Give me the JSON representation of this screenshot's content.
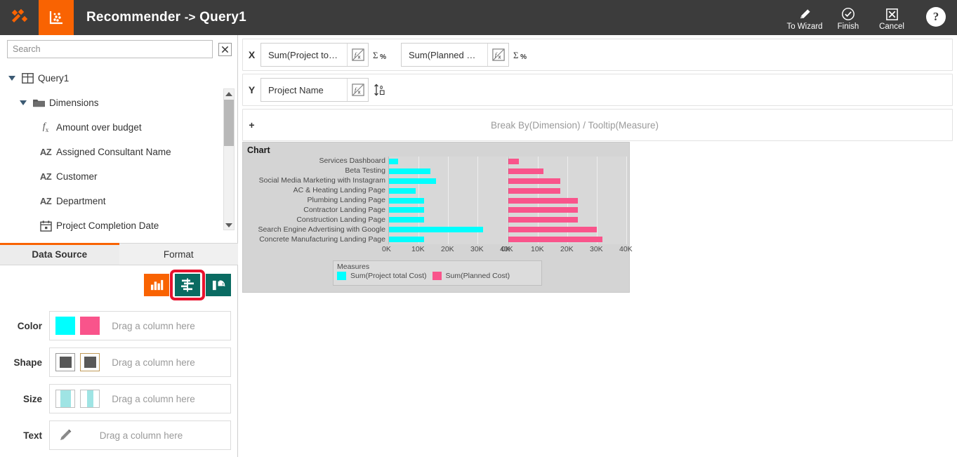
{
  "topbar": {
    "title_main": "Recommender",
    "title_arrow": "->",
    "title_query": "Query1",
    "app_icon": "scatter-plot-icon",
    "logo_icon": "tools-logo-icon",
    "actions": [
      {
        "label": "To Wizard",
        "icon": "pencil-icon"
      },
      {
        "label": "Finish",
        "icon": "check-circle-icon"
      },
      {
        "label": "Cancel",
        "icon": "x-box-icon"
      }
    ],
    "help_label": "?",
    "bg_color": "#3c3c3c",
    "accent_color": "#F96302"
  },
  "sidebar": {
    "search": {
      "placeholder": "Search",
      "value": ""
    },
    "clear_label": "✕",
    "tree": [
      {
        "label": "Query1",
        "icon": "table-icon",
        "indent": 0,
        "expanded": true
      },
      {
        "label": "Dimensions",
        "icon": "folder-icon",
        "indent": 1,
        "expanded": true
      },
      {
        "label": "Amount over budget",
        "icon": "formula-icon",
        "indent": 2,
        "expanded": false
      },
      {
        "label": "Assigned Consultant Name",
        "icon": "text-az-icon",
        "indent": 2,
        "expanded": false
      },
      {
        "label": "Customer",
        "icon": "text-az-icon",
        "indent": 2,
        "expanded": false
      },
      {
        "label": "Department",
        "icon": "text-az-icon",
        "indent": 2,
        "expanded": false
      },
      {
        "label": "Project Completion Date",
        "icon": "calendar-icon",
        "indent": 2,
        "expanded": false
      }
    ],
    "tabs": [
      {
        "label": "Data Source",
        "active": true
      },
      {
        "label": "Format",
        "active": false
      }
    ],
    "vis_buttons": [
      {
        "name": "bar-chart-vis",
        "icon": "bar-chart-icon",
        "selected": false,
        "color": "#F96302"
      },
      {
        "name": "diverging-bar-vis",
        "icon": "diverging-bar-icon",
        "selected": true,
        "color": "#0A6B62"
      },
      {
        "name": "rotate-chart-vis",
        "icon": "rotate-chart-icon",
        "selected": false,
        "color": "#0A6B62"
      }
    ],
    "drop_shelves": [
      {
        "label": "Color",
        "placeholder": "Drag a column here",
        "swatch_type": "color",
        "swatches": [
          "#00FFFF",
          "#F9548B"
        ]
      },
      {
        "label": "Shape",
        "placeholder": "Drag a column here",
        "swatch_type": "shape",
        "swatches": [
          "#595959",
          "#595959"
        ]
      },
      {
        "label": "Size",
        "placeholder": "Drag a column here",
        "swatch_type": "size",
        "swatches": [
          "#9FE4E4",
          "#9FE4E4"
        ]
      },
      {
        "label": "Text",
        "placeholder": "Drag a column here",
        "swatch_type": "pencil",
        "swatches": []
      }
    ]
  },
  "shelves": {
    "x": {
      "key": "X",
      "fields": [
        {
          "text": "Sum(Project total Co...",
          "fx_icon": "fx-slash-icon",
          "agg_icon": "Σ‰",
          "agg_name": "sum-percent-icon"
        },
        {
          "text": "Sum(Planned Cost)",
          "fx_icon": "fx-slash-icon",
          "agg_icon": "Σ‰",
          "agg_name": "sum-percent-icon"
        }
      ]
    },
    "y": {
      "key": "Y",
      "fields": [
        {
          "text": "Project Name",
          "fx_icon": "fx-slash-icon",
          "agg_icon": "↕",
          "agg_name": "sort-icon"
        }
      ]
    },
    "breakby": {
      "key": "+",
      "placeholder": "Break By(Dimension) / Tooltip(Measure)"
    }
  },
  "chart_data": {
    "type": "bar",
    "title": "Chart",
    "orientation": "horizontal",
    "layout": "mirrored-panels",
    "categories": [
      "Services Dashboard",
      "Beta Testing",
      "Social Media Marketing with Instagram",
      "AC & Heating Landing Page",
      "Plumbing Landing Page",
      "Contractor Landing Page",
      "Construction Landing Page",
      "Search Engine Advertising with Google",
      "Concrete Manufacturing Landing Page"
    ],
    "series": [
      {
        "name": "Sum(Project total  Cost)",
        "color": "#00FFFF",
        "values": [
          3000,
          14000,
          16000,
          9000,
          12000,
          12000,
          12000,
          32000,
          12000
        ]
      },
      {
        "name": "Sum(Planned Cost)",
        "color": "#F9548B",
        "values": [
          3500,
          12000,
          17500,
          17500,
          23500,
          23500,
          23500,
          30000,
          32000
        ]
      }
    ],
    "xlabel": "",
    "ylabel": "",
    "xlim": [
      0,
      40000
    ],
    "xticks": [
      "0K",
      "10K",
      "20K",
      "30K",
      "40K"
    ],
    "grid": true,
    "legend": {
      "title": "Measures",
      "position": "bottom",
      "entries": [
        {
          "label": "Sum(Project total  Cost)",
          "color": "#00FFFF"
        },
        {
          "label": "Sum(Planned Cost)",
          "color": "#F9548B"
        }
      ]
    }
  }
}
